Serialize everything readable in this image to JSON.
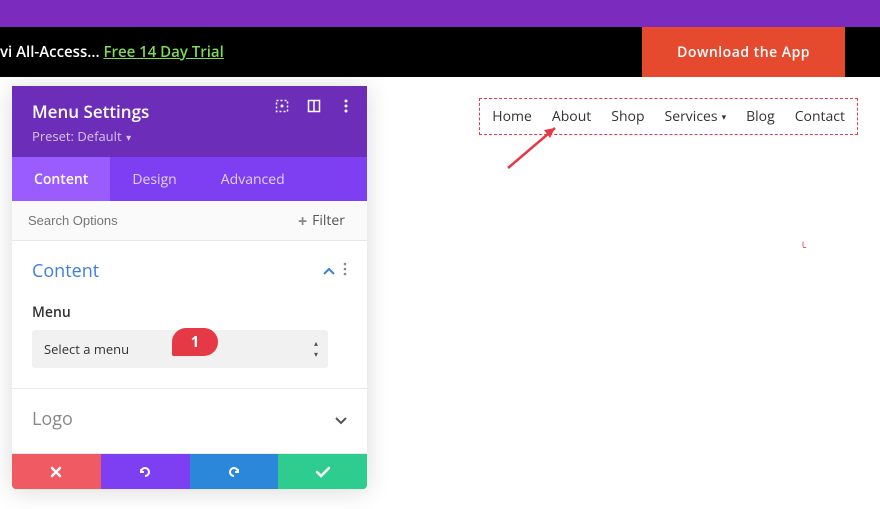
{
  "topbar": {
    "promo_prefix": "vi All-Access... ",
    "promo_link": "Free 14 Day Trial",
    "download_label": "Download the App"
  },
  "panel": {
    "title": "Menu Settings",
    "preset_label": "Preset: Default",
    "tabs": {
      "content": "Content",
      "design": "Design",
      "advanced": "Advanced"
    },
    "search_placeholder": "Search Options",
    "filter_label": "Filter",
    "section_content": "Content",
    "field_menu_label": "Menu",
    "select_placeholder": "Select a menu",
    "section_logo": "Logo"
  },
  "annotation": {
    "badge": "1"
  },
  "nav": {
    "items": [
      {
        "label": "Home"
      },
      {
        "label": "About"
      },
      {
        "label": "Shop"
      },
      {
        "label": "Services",
        "dropdown": true
      },
      {
        "label": "Blog"
      },
      {
        "label": "Contact"
      }
    ]
  }
}
